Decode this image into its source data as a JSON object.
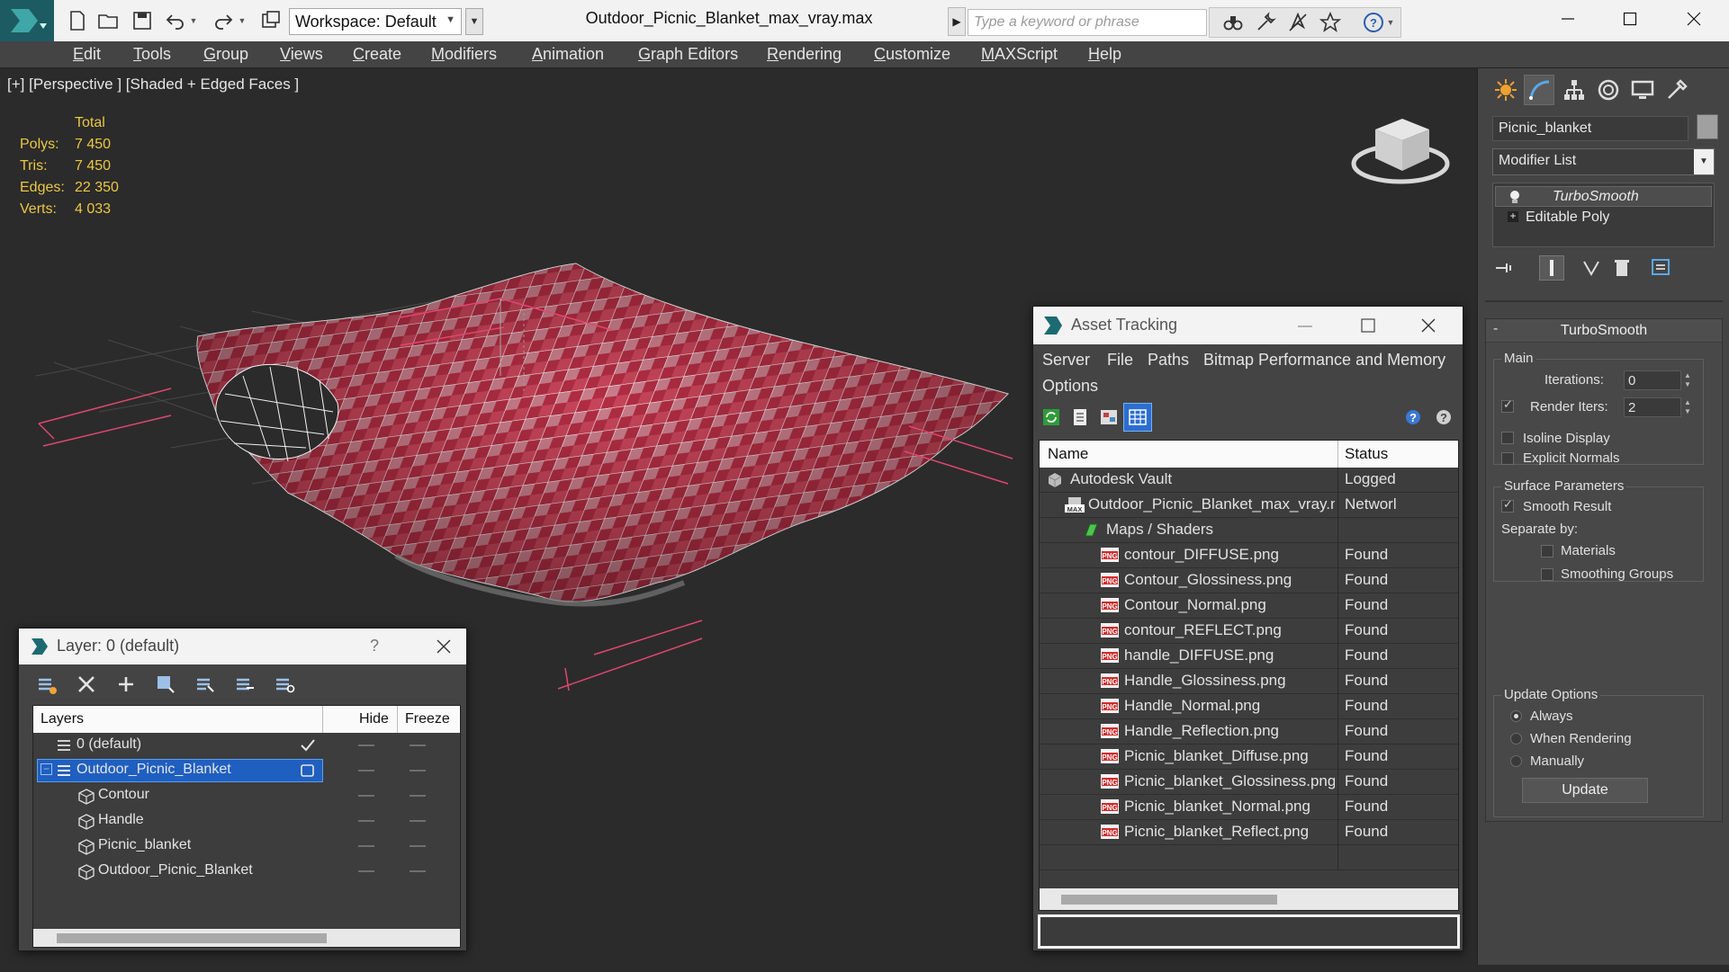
{
  "titlebar": {
    "workspace_label": "Workspace: Default",
    "file_title": "Outdoor_Picnic_Blanket_max_vray.max",
    "search_placeholder": "Type a keyword or phrase"
  },
  "menubar": {
    "items": [
      "Edit",
      "Tools",
      "Group",
      "Views",
      "Create",
      "Modifiers",
      "Animation",
      "Graph Editors",
      "Rendering",
      "Customize",
      "MAXScript",
      "Help"
    ]
  },
  "viewport": {
    "label": "[+] [Perspective ] [Shaded + Edged Faces ]",
    "stats": {
      "header": "Total",
      "rows": [
        {
          "label": "Polys:",
          "value": "7 450"
        },
        {
          "label": "Tris:",
          "value": "7 450"
        },
        {
          "label": "Edges:",
          "value": "22 350"
        },
        {
          "label": "Verts:",
          "value": "4 033"
        }
      ]
    },
    "colors": {
      "stats": "#ecc743",
      "selection_bracket": "#e0476e",
      "blanket": "#b8263a"
    }
  },
  "asset_tracking": {
    "title": "Asset Tracking",
    "menu": [
      "Server",
      "File",
      "Paths",
      "Bitmap Performance and Memory",
      "Options"
    ],
    "columns": [
      "Name",
      "Status"
    ],
    "rows": [
      {
        "name": "Autodesk Vault",
        "status": "Logged",
        "icon": "vault-icon"
      },
      {
        "name": "Outdoor_Picnic_Blanket_max_vray.max",
        "status": "Networl",
        "icon": "max-file-icon"
      },
      {
        "name": "Maps / Shaders",
        "status": "",
        "icon": "maps-folder-icon"
      },
      {
        "name": "contour_DIFFUSE.png",
        "status": "Found",
        "icon": "png-icon"
      },
      {
        "name": "Contour_Glossiness.png",
        "status": "Found",
        "icon": "png-icon"
      },
      {
        "name": "Contour_Normal.png",
        "status": "Found",
        "icon": "png-icon"
      },
      {
        "name": "contour_REFLECT.png",
        "status": "Found",
        "icon": "png-icon"
      },
      {
        "name": "handle_DIFFUSE.png",
        "status": "Found",
        "icon": "png-icon"
      },
      {
        "name": "Handle_Glossiness.png",
        "status": "Found",
        "icon": "png-icon"
      },
      {
        "name": "Handle_Normal.png",
        "status": "Found",
        "icon": "png-icon"
      },
      {
        "name": "Handle_Reflection.png",
        "status": "Found",
        "icon": "png-icon"
      },
      {
        "name": "Picnic_blanket_Diffuse.png",
        "status": "Found",
        "icon": "png-icon"
      },
      {
        "name": "Picnic_blanket_Glossiness.png",
        "status": "Found",
        "icon": "png-icon"
      },
      {
        "name": "Picnic_blanket_Normal.png",
        "status": "Found",
        "icon": "png-icon"
      },
      {
        "name": "Picnic_blanket_Reflect.png",
        "status": "Found",
        "icon": "png-icon"
      }
    ]
  },
  "layer_window": {
    "title": "Layer: 0 (default)",
    "help": "?",
    "columns": [
      "Layers",
      "Hide",
      "Freeze"
    ],
    "rows": [
      {
        "name": "0 (default)",
        "icon": "layer-stack-icon"
      },
      {
        "name": "Outdoor_Picnic_Blanket",
        "icon": "layer-stack-icon"
      },
      {
        "name": "Contour",
        "icon": "object-box-icon"
      },
      {
        "name": "Handle",
        "icon": "object-box-icon"
      },
      {
        "name": "Picnic_blanket",
        "icon": "object-box-icon"
      },
      {
        "name": "Outdoor_Picnic_Blanket",
        "icon": "object-box-icon"
      }
    ]
  },
  "command_panel": {
    "object_name": "Picnic_blanket",
    "modifier_list": "Modifier List",
    "stack": [
      "TurboSmooth",
      "Editable Poly"
    ],
    "rollout_title": "TurboSmooth",
    "main_group": "Main",
    "iterations_label": "Iterations:",
    "iterations_value": "0",
    "render_iters_label": "Render Iters:",
    "render_iters_value": "2",
    "render_iters_checked": true,
    "isoline_display": "Isoline Display",
    "explicit_normals": "Explicit Normals",
    "surface_params_group": "Surface Parameters",
    "smooth_result": "Smooth Result",
    "smooth_result_checked": true,
    "separate_by": "Separate by:",
    "materials": "Materials",
    "smoothing_groups": "Smoothing Groups",
    "update_options_group": "Update Options",
    "update_options": [
      "Always",
      "When Rendering",
      "Manually"
    ],
    "update_selected": "Always",
    "update_button": "Update"
  }
}
